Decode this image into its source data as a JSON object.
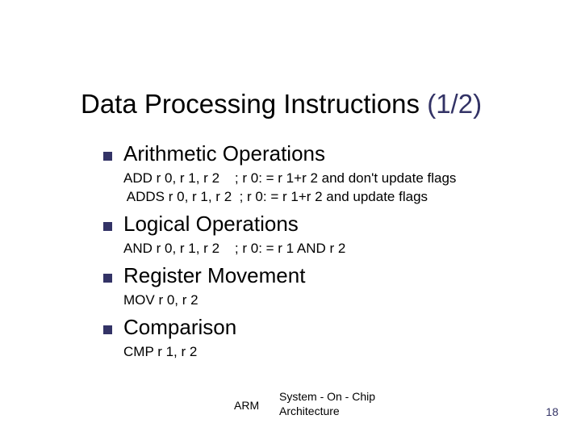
{
  "title": {
    "main": "Data Processing Instructions",
    "part": "(1/2)"
  },
  "sections": [
    {
      "heading": "Arithmetic Operations",
      "code": "ADD r 0, r 1, r 2    ; r 0: = r 1+r 2 and don't update flags\n ADDS r 0, r 1, r 2  ; r 0: = r 1+r 2 and update flags"
    },
    {
      "heading": "Logical Operations",
      "code": "AND r 0, r 1, r 2    ; r 0: = r 1 AND r 2"
    },
    {
      "heading": "Register Movement",
      "code": "MOV r 0, r 2"
    },
    {
      "heading": "Comparison",
      "code": "CMP r 1, r 2"
    }
  ],
  "footer": {
    "left": "ARM",
    "center_line1": "System - On - Chip",
    "center_line2": "Architecture",
    "page": "18"
  }
}
